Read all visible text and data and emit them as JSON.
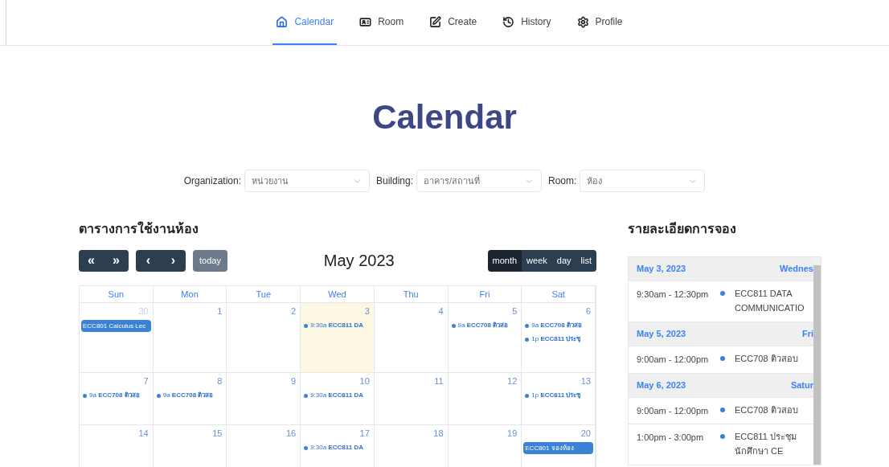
{
  "nav": [
    {
      "label": "Calendar",
      "selected": true
    },
    {
      "label": "Room",
      "selected": false
    },
    {
      "label": "Create",
      "selected": false
    },
    {
      "label": "History",
      "selected": false
    },
    {
      "label": "Profile",
      "selected": false
    }
  ],
  "title": "Calendar",
  "filters": [
    {
      "label": "Organization:",
      "placeholder": "หน่วยงาน"
    },
    {
      "label": "Building:",
      "placeholder": "อาคาร/สถานที่"
    },
    {
      "label": "Room:",
      "placeholder": "ห้อง"
    }
  ],
  "calendar": {
    "heading": "ตารางการใช้งานห้อง",
    "nav_buttons": [
      [
        "«",
        "»"
      ],
      [
        "‹",
        "›"
      ]
    ],
    "today_button": "today",
    "month_title": "May 2023",
    "views": [
      {
        "label": "month",
        "selected": true
      },
      {
        "label": "week",
        "selected": false
      },
      {
        "label": "day",
        "selected": false
      },
      {
        "label": "list",
        "selected": false
      }
    ],
    "weekdays": [
      "Sun",
      "Mon",
      "Tue",
      "Wed",
      "Thu",
      "Fri",
      "Sat"
    ],
    "weeks": [
      [
        {
          "day": "30",
          "other_month": true,
          "today": false,
          "events": [
            {
              "kind": "block",
              "title": "ECC801 Calculus Lec"
            }
          ]
        },
        {
          "day": "1",
          "other_month": false,
          "today": false
        },
        {
          "day": "2",
          "other_month": false,
          "today": false
        },
        {
          "day": "3",
          "other_month": false,
          "today": true,
          "events": [
            {
              "kind": "dot",
              "time": "9:30a",
              "title": "ECC811 DA"
            }
          ]
        },
        {
          "day": "4",
          "other_month": false,
          "today": false
        },
        {
          "day": "5",
          "other_month": false,
          "today": false,
          "events": [
            {
              "kind": "dot",
              "time": "9a",
              "title": "ECC708 ติวสอ"
            }
          ]
        },
        {
          "day": "6",
          "other_month": false,
          "today": false,
          "events": [
            {
              "kind": "dot",
              "time": "9a",
              "title": "ECC708 ติวสอ"
            },
            {
              "kind": "dot",
              "time": "1p",
              "title": "ECC811 ประชุ"
            }
          ]
        }
      ],
      [
        {
          "day": "7",
          "other_month": false,
          "today": false,
          "events": [
            {
              "kind": "dot",
              "time": "9a",
              "title": "ECC708 ติวสอ"
            }
          ]
        },
        {
          "day": "8",
          "other_month": false,
          "today": false,
          "events": [
            {
              "kind": "dot",
              "time": "9a",
              "title": "ECC708 ติวสอ"
            }
          ]
        },
        {
          "day": "9",
          "other_month": false,
          "today": false
        },
        {
          "day": "10",
          "other_month": false,
          "today": false,
          "events": [
            {
              "kind": "dot",
              "time": "9:30a",
              "title": "ECC811 DA"
            }
          ]
        },
        {
          "day": "11",
          "other_month": false,
          "today": false
        },
        {
          "day": "12",
          "other_month": false,
          "today": false
        },
        {
          "day": "13",
          "other_month": false,
          "today": false,
          "events": [
            {
              "kind": "dot",
              "time": "1p",
              "title": "ECC811 ประชุ"
            }
          ]
        }
      ],
      [
        {
          "day": "14",
          "other_month": false,
          "today": false
        },
        {
          "day": "15",
          "other_month": false,
          "today": false
        },
        {
          "day": "16",
          "other_month": false,
          "today": false
        },
        {
          "day": "17",
          "other_month": false,
          "today": false,
          "events": [
            {
              "kind": "dot",
              "time": "9:30a",
              "title": "ECC811 DA"
            }
          ]
        },
        {
          "day": "18",
          "other_month": false,
          "today": false
        },
        {
          "day": "19",
          "other_month": false,
          "today": false
        },
        {
          "day": "20",
          "other_month": false,
          "today": false,
          "events": [
            {
              "kind": "block",
              "title": "ECC801 จองห้อง"
            }
          ]
        }
      ]
    ]
  },
  "details": {
    "heading": "รายละเอียดการจอง",
    "groups": [
      {
        "date": "May 3, 2023",
        "weekday": "Wednes",
        "items": [
          {
            "time": "9:30am - 12:30pm",
            "title": "ECC811 DATA COMMUNICATIO"
          }
        ]
      },
      {
        "date": "May 5, 2023",
        "weekday": "Fri",
        "items": [
          {
            "time": "9:00am - 12:00pm",
            "title": "ECC708 ติวสอบ"
          }
        ]
      },
      {
        "date": "May 6, 2023",
        "weekday": "Satur",
        "items": [
          {
            "time": "9:00am - 12:00pm",
            "title": "ECC708 ติวสอบ"
          },
          {
            "time": "1:00pm - 3:00pm",
            "title": "ECC811 ประชุม นักศึกษา CE"
          }
        ]
      }
    ]
  }
}
